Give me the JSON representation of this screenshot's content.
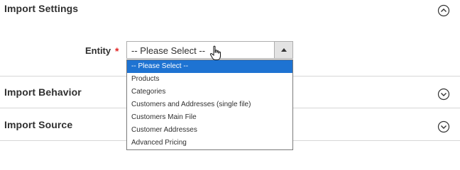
{
  "sections": {
    "import_settings": {
      "title": "Import Settings",
      "toggle_icon": "chevron-up-circle-icon"
    },
    "import_behavior": {
      "title": "Import Behavior",
      "toggle_icon": "chevron-down-circle-icon"
    },
    "import_source": {
      "title": "Import Source",
      "toggle_icon": "chevron-down-circle-icon"
    }
  },
  "entity_field": {
    "label": "Entity",
    "required_marker": "*",
    "selected_value": "-- Please Select --",
    "arrow_icon": "triangle-up-icon"
  },
  "dropdown": {
    "options": [
      {
        "label": "-- Please Select --",
        "selected": true
      },
      {
        "label": "Products",
        "selected": false
      },
      {
        "label": "Categories",
        "selected": false
      },
      {
        "label": "Customers and Addresses (single file)",
        "selected": false
      },
      {
        "label": "Customers Main File",
        "selected": false
      },
      {
        "label": "Customer Addresses",
        "selected": false
      },
      {
        "label": "Advanced Pricing",
        "selected": false
      }
    ]
  },
  "colors": {
    "required": "#e22626",
    "selected_option_bg": "#1e73d2",
    "divider": "#d6d6d6"
  }
}
